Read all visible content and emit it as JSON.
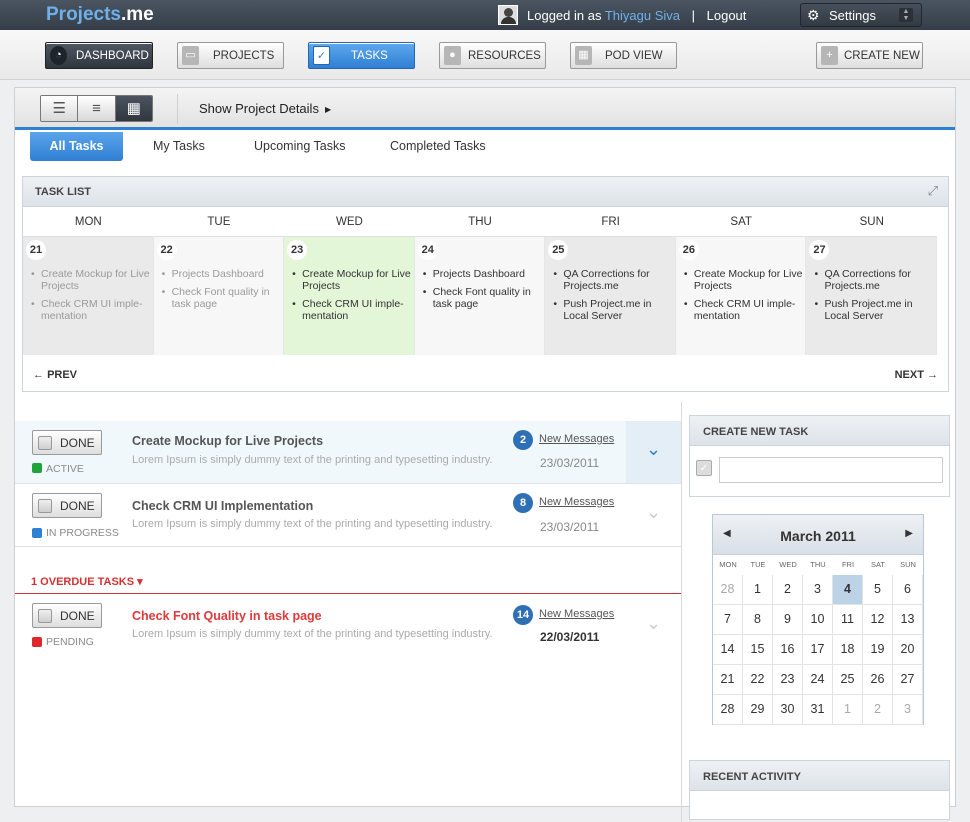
{
  "app": {
    "logo_a": "Projects",
    "logo_b": ".me"
  },
  "user": {
    "prefix": "Logged in as",
    "name": "Thiyagu Siva",
    "sep": "|",
    "logout": "Logout"
  },
  "settings": {
    "label": "Settings"
  },
  "nav": {
    "dashboard": "DASHBOARD",
    "projects": "PROJECTS",
    "tasks": "TASKS",
    "resources": "RESOURCES",
    "pod_view": "POD VIEW",
    "create_new": "CREATE NEW"
  },
  "toolbar": {
    "show_details": "Show Project Details"
  },
  "tabs": [
    "All Tasks",
    "My Tasks",
    "Upcoming Tasks",
    "Completed Tasks"
  ],
  "task_list": {
    "title": "TASK LIST",
    "days": [
      "MON",
      "TUE",
      "WED",
      "THU",
      "FRI",
      "SAT",
      "SUN"
    ],
    "cells": [
      {
        "date": "21",
        "items": [
          "Create Mockup for Live Projects",
          "Check CRM UI imple-mentation"
        ]
      },
      {
        "date": "22",
        "items": [
          "Projects Dashboard",
          "Check Font quality in task page"
        ]
      },
      {
        "date": "23",
        "items": [
          "Create Mockup for Live Projects",
          "Check CRM UI imple-mentation"
        ]
      },
      {
        "date": "24",
        "items": [
          "Projects Dashboard",
          "Check Font quality in task page"
        ]
      },
      {
        "date": "25",
        "items": [
          "QA  Corrections for Projects.me",
          "Push Project.me in Local Server"
        ]
      },
      {
        "date": "26",
        "items": [
          "Create Mockup for Live Projects",
          "Check CRM UI imple-mentation"
        ]
      },
      {
        "date": "27",
        "items": [
          "QA  Corrections for Projects.me",
          "Push Project.me in Local Server"
        ]
      }
    ],
    "prev": "PREV",
    "next": "NEXT"
  },
  "tasks": [
    {
      "done": "DONE",
      "status": "ACTIVE",
      "status_color": "#1fa43a",
      "title": "Create Mockup for Live Projects",
      "desc": "Lorem Ipsum is simply dummy text of the printing and typesetting industry.",
      "count": "2",
      "msg": "New Messages",
      "date": "23/03/2011"
    },
    {
      "done": "DONE",
      "status": "IN PROGRESS",
      "status_color": "#2f7fd3",
      "title": "Check CRM UI Implementation",
      "desc": "Lorem Ipsum is simply dummy text of the printing and typesetting industry.",
      "count": "8",
      "msg": "New Messages",
      "date": "23/03/2011"
    }
  ],
  "overdue": {
    "label": "1 OVERDUE TASKS",
    "caret": "▾"
  },
  "overdue_task": {
    "done": "DONE",
    "status": "PENDING",
    "status_color": "#e0262a",
    "title": "Check Font Quality in task page",
    "desc": "Lorem Ipsum is simply dummy text of the printing and typesetting industry.",
    "count": "14",
    "msg": "New Messages",
    "date": "22/03/2011"
  },
  "create_task": {
    "title": "CREATE NEW TASK",
    "check": "✓"
  },
  "calendar": {
    "month": "March 2011",
    "weekdays": [
      "MON",
      "TUE",
      "WED",
      "THU",
      "FRI",
      "SAT",
      "SUN"
    ],
    "days": [
      "28",
      "1",
      "2",
      "3",
      "4",
      "5",
      "6",
      "7",
      "8",
      "9",
      "10",
      "11",
      "12",
      "13",
      "14",
      "15",
      "16",
      "17",
      "18",
      "19",
      "20",
      "21",
      "22",
      "23",
      "24",
      "25",
      "26",
      "27",
      "28",
      "29",
      "30",
      "31",
      "1",
      "2",
      "3"
    ],
    "selected": "4"
  },
  "recent_activity": {
    "title": "RECENT ACTIVITY"
  },
  "colors": {
    "accent": "#2f7fd3",
    "topbar": "#3b444e",
    "highlight_day": "#e4f6d8",
    "overdue": "#d63030"
  },
  "icons": [
    "gear-icon",
    "dashboard-icon",
    "projects-icon",
    "tasks-check-icon",
    "resources-icon",
    "pod-view-icon",
    "create-new-icon",
    "list-view-icon",
    "gantt-view-icon",
    "calendar-view-icon",
    "expand-icon",
    "chevron-down-icon"
  ]
}
